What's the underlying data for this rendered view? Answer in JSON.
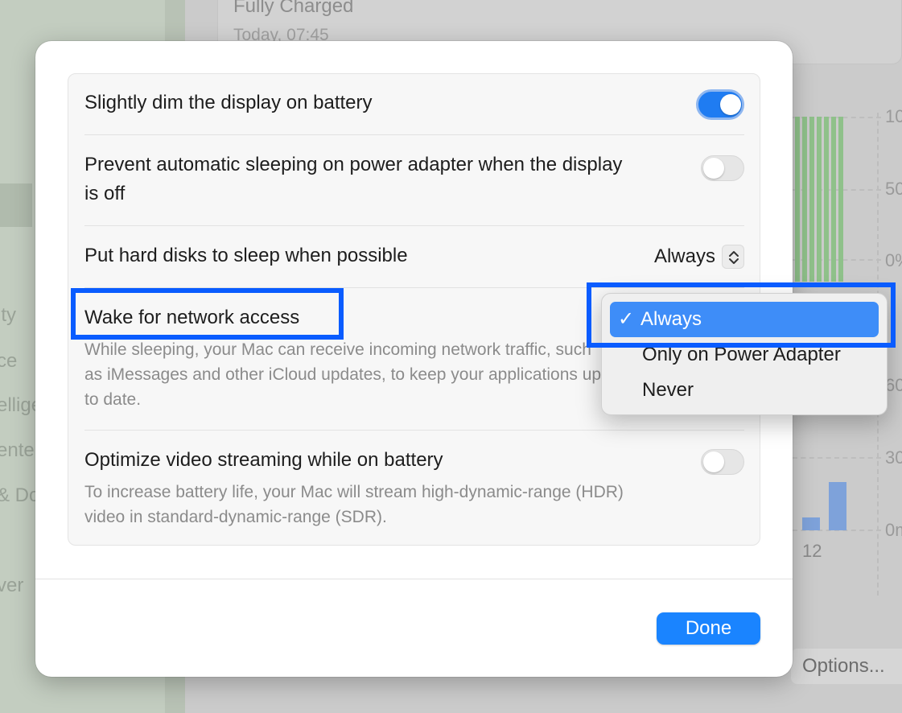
{
  "background": {
    "sidebar_fragments": [
      "ity",
      "ce",
      "ellige",
      "ente",
      "& Do",
      "ver"
    ],
    "title": "Fully Charged",
    "subtitle": "Today, 07:45",
    "chart_ticks_right": [
      "10",
      "50",
      "0%",
      "60",
      "30",
      "0m"
    ],
    "chart_x_tick": "12",
    "options_button": "Options..."
  },
  "dialog": {
    "rows": [
      {
        "label": "Slightly dim the display on battery",
        "toggle": "on"
      },
      {
        "label": "Prevent automatic sleeping on power adapter when the display is off",
        "toggle": "off"
      },
      {
        "label": "Put hard disks to sleep when possible",
        "popup_value": "Always"
      },
      {
        "label": "Wake for network access",
        "description": "While sleeping, your Mac can receive incoming network traffic, such as iMessages and other iCloud updates, to keep your applications up to date."
      },
      {
        "label": "Optimize video streaming while on battery",
        "toggle": "off",
        "description": "To increase battery life, your Mac will stream high-dynamic-range (HDR) video in standard-dynamic-range (SDR)."
      }
    ],
    "done_label": "Done"
  },
  "menu": {
    "items": [
      {
        "label": "Always",
        "selected": true,
        "check": "✓"
      },
      {
        "label": "Only on Power Adapter",
        "selected": false
      },
      {
        "label": "Never",
        "selected": false
      }
    ]
  },
  "colors": {
    "accent": "#1a84ff",
    "highlight_box": "#0a5cff",
    "menu_selected": "#3e8df8"
  }
}
